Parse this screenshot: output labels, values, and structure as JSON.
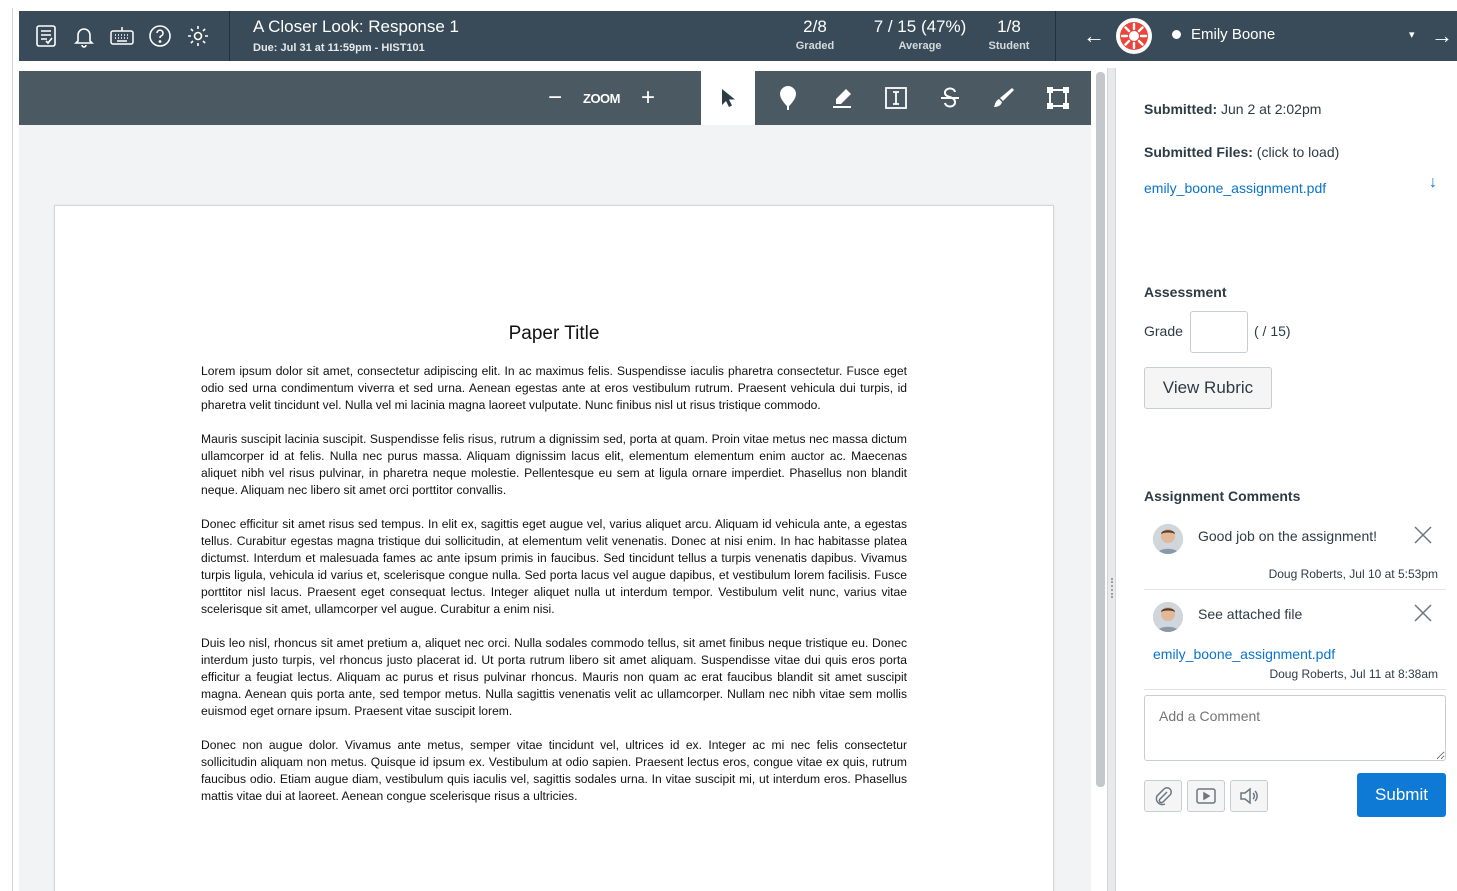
{
  "header": {
    "icons": [
      "speedgrader-icon",
      "bell-icon",
      "keyboard-icon",
      "help-icon",
      "gear-icon"
    ],
    "title": "A Closer Look: Response 1",
    "due": "Due: Jul 31 at 11:59pm - HIST101",
    "stats": [
      {
        "value": "2/8",
        "label": "Graded"
      },
      {
        "value": "7 / 15 (47%)",
        "label": "Average"
      },
      {
        "value": "1/8",
        "label": "Student"
      }
    ],
    "prev_arrow": "←",
    "next_arrow": "→",
    "student_name": "Emily Boone",
    "caret": "▾"
  },
  "toolbar": {
    "zoom_out": "−",
    "zoom_label": "ZOOM",
    "zoom_in": "+",
    "tools": [
      "pointer-icon",
      "point-annotation-icon",
      "highlight-icon",
      "text-icon",
      "strikeout-icon",
      "freedraw-icon",
      "area-icon"
    ]
  },
  "document": {
    "title": "Paper Title",
    "paragraphs": [
      "Lorem ipsum dolor sit amet, consectetur adipiscing elit. In ac maximus felis. Suspendisse iaculis pharetra consectetur. Fusce eget odio sed urna condimentum viverra et sed urna. Aenean egestas ante at eros vestibulum rutrum. Praesent vehicula dui turpis, id pharetra velit tincidunt vel. Nulla vel mi lacinia magna laoreet vulputate. Nunc finibus nisl ut risus tristique commodo.",
      "Mauris suscipit lacinia suscipit. Suspendisse felis risus, rutrum a dignissim sed, porta at quam. Proin vitae metus nec massa dictum ullamcorper id at felis. Nulla nec purus massa. Aliquam dignissim lacus elit, elementum elementum enim auctor ac. Maecenas aliquet nibh vel risus pulvinar, in pharetra neque molestie. Pellentesque eu sem at ligula ornare imperdiet. Phasellus non blandit neque. Aliquam nec libero sit amet orci porttitor convallis.",
      "Donec efficitur sit amet risus sed tempus. In elit ex, sagittis eget augue vel, varius aliquet arcu. Aliquam id vehicula ante, a egestas tellus. Curabitur egestas magna tristique dui sollicitudin, at elementum velit venenatis. Donec at nisi enim. In hac habitasse platea dictumst. Interdum et malesuada fames ac ante ipsum primis in faucibus. Sed tincidunt tellus a turpis venenatis dapibus. Vivamus turpis ligula, vehicula id varius et, scelerisque congue nulla. Sed porta lacus vel augue dapibus, et vestibulum lorem facilisis. Fusce porttitor nisl lacus. Praesent eget consequat lectus. Integer aliquet nulla ut interdum tempor. Vestibulum velit nunc, varius vitae scelerisque sit amet, ullamcorper vel augue. Curabitur a enim nisi.",
      "Duis leo nisl, rhoncus sit amet pretium a, aliquet nec orci. Nulla sodales commodo tellus, sit amet finibus neque tristique eu. Donec interdum justo turpis, vel rhoncus justo placerat id. Ut porta rutrum libero sit amet aliquam. Suspendisse vitae dui quis eros porta efficitur a feugiat lectus. Aliquam ac purus et risus pulvinar rhoncus. Mauris non quam ac erat faucibus blandit sit amet suscipit magna. Aenean quis porta ante, sed tempor metus. Nulla sagittis venenatis velit ac ullamcorper. Nullam nec nibh vitae sem mollis euismod eget ornare ipsum. Praesent vitae suscipit lorem.",
      "Donec non augue dolor. Vivamus ante metus, semper vitae tincidunt vel, ultrices id ex. Integer ac mi nec felis consectetur sollicitudin aliquam non metus. Quisque id ipsum ex. Vestibulum at odio sapien. Praesent lectus eros, congue vitae ex quis, rutrum faucibus odio. Etiam augue diam, vestibulum quis iaculis vel, sagittis sodales urna. In vitae suscipit mi, ut interdum eros. Phasellus mattis vitae dui at laoreet. Aenean congue scelerisque risus a ultricies."
    ]
  },
  "sidebar": {
    "submitted_label": "Submitted:",
    "submitted_value": "Jun 2 at 2:02pm",
    "files_label": "Submitted Files:",
    "files_hint": "(click to load)",
    "file_name": "emily_boone_assignment.pdf",
    "download_icon": "↓",
    "assessment_heading": "Assessment",
    "grade_label": "Grade",
    "grade_value": "",
    "grade_out_of": "( / 15)",
    "view_rubric": "View Rubric",
    "comments_heading": "Assignment Comments",
    "comments": [
      {
        "text": "Good job on the assignment!",
        "author": "Doug Roberts, Jul 10 at 5:53pm",
        "attachment": ""
      },
      {
        "text": "See attached file",
        "author": "Doug Roberts, Jul 11 at 8:38am",
        "attachment": "emily_boone_assignment.pdf"
      }
    ],
    "comment_placeholder": "Add a Comment",
    "submit_label": "Submit"
  },
  "colors": {
    "header_bg": "#394b58",
    "toolbar_bg": "#4b5963",
    "link": "#0a73cc",
    "submit": "#0e7ad6"
  }
}
